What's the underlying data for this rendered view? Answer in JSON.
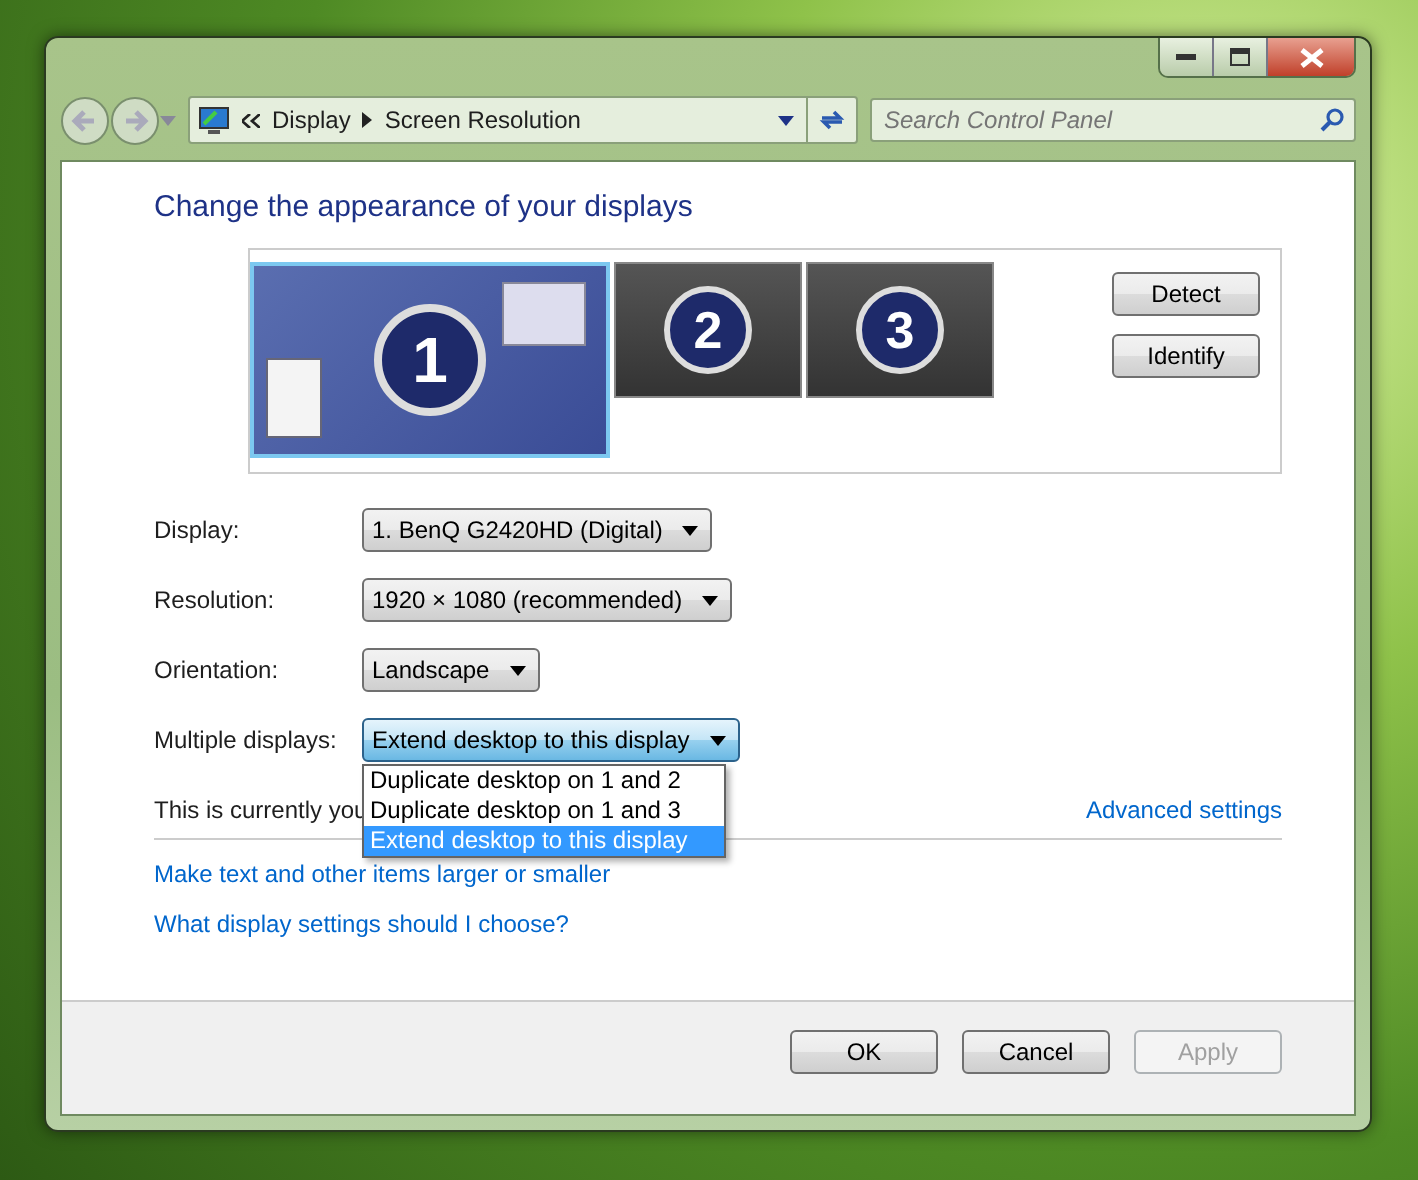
{
  "window": {
    "breadcrumb": [
      "Display",
      "Screen Resolution"
    ],
    "search": {
      "placeholder": "Search Control Panel"
    }
  },
  "heading": "Change the appearance of your displays",
  "monitors": [
    {
      "number": "1",
      "selected": true
    },
    {
      "number": "2",
      "selected": false
    },
    {
      "number": "3",
      "selected": false
    }
  ],
  "monitor_buttons": [
    "Detect",
    "Identify"
  ],
  "fields": [
    {
      "label": "Display:",
      "value": "1. BenQ G2420HD (Digital)",
      "expanded": false
    },
    {
      "label": "Resolution:",
      "value": "1920 × 1080 (recommended)",
      "expanded": false
    },
    {
      "label": "Orientation:",
      "value": "Landscape",
      "expanded": false
    },
    {
      "label": "Multiple displays:",
      "value": "Extend desktop to this display",
      "expanded": true
    }
  ],
  "dropdown_options": [
    {
      "label": "Duplicate desktop on 1 and 2",
      "selected": false
    },
    {
      "label": "Duplicate desktop on 1 and 3",
      "selected": false
    },
    {
      "label": "Extend desktop to this display",
      "selected": true
    }
  ],
  "status_text": "This is currently you",
  "advanced_link": "Advanced settings",
  "links": [
    "Make text and other items larger or smaller",
    "What display settings should I choose?"
  ],
  "buttons": [
    {
      "label": "OK",
      "disabled": false
    },
    {
      "label": "Cancel",
      "disabled": false
    },
    {
      "label": "Apply",
      "disabled": true
    }
  ]
}
